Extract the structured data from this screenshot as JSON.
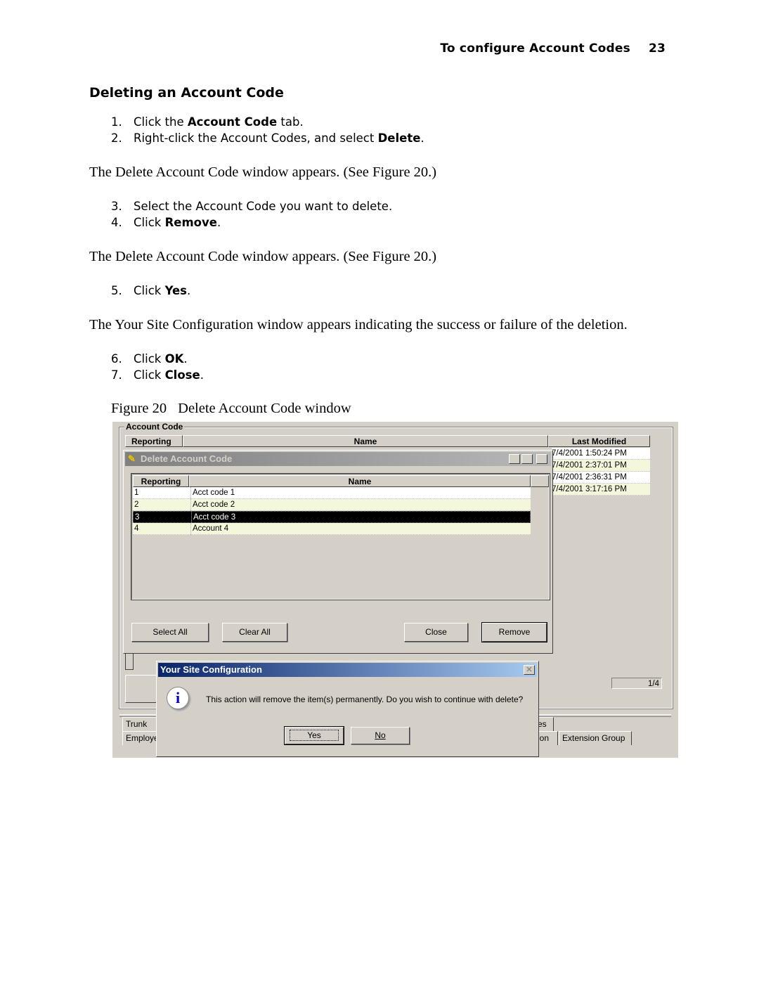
{
  "header": {
    "title": "To configure Account Codes",
    "page_number": "23"
  },
  "section_title": "Deleting an Account Code",
  "steps_a": [
    {
      "num": "1.",
      "pre": "Click the ",
      "bold": "Account Code",
      "post": " tab."
    },
    {
      "num": "2.",
      "pre": "Right-click the Account Codes, and select ",
      "bold": "Delete",
      "post": "."
    }
  ],
  "para1": "The Delete Account Code window appears. (See Figure 20.)",
  "steps_b": [
    {
      "num": "3.",
      "pre": "Select the Account Code you want to delete.",
      "bold": "",
      "post": ""
    },
    {
      "num": "4.",
      "pre": "Click ",
      "bold": "Remove",
      "post": "."
    }
  ],
  "para2": "The Delete Account Code window appears. (See Figure 20.)",
  "steps_c": [
    {
      "num": "5.",
      "pre": "Click ",
      "bold": "Yes",
      "post": "."
    }
  ],
  "para3": "The Your Site Configuration window appears indicating the success or failure of the deletion.",
  "steps_d": [
    {
      "num": "6.",
      "pre": "Click ",
      "bold": "OK",
      "post": "."
    },
    {
      "num": "7.",
      "pre": "Click ",
      "bold": "Close",
      "post": "."
    }
  ],
  "figure": {
    "label": "Figure 20",
    "caption": "Delete Account Code window"
  },
  "screenshot": {
    "group_label": "Account Code",
    "bg_columns": {
      "reporting": "Reporting",
      "name": "Name",
      "last_modified": "Last Modified"
    },
    "last_modified_values": [
      "7/4/2001 1:50:24 PM",
      "7/4/2001 2:37:01 PM",
      "7/4/2001 2:36:31 PM",
      "7/4/2001 3:17:16 PM"
    ],
    "page_indicator": "1/4",
    "delete_dialog": {
      "title": "Delete Account Code",
      "columns": {
        "reporting": "Reporting",
        "name": "Name"
      },
      "rows": [
        {
          "reporting": "1",
          "name": "Acct code 1"
        },
        {
          "reporting": "2",
          "name": "Acct code 2"
        },
        {
          "reporting": "3",
          "name": "Acct code 3"
        },
        {
          "reporting": "4",
          "name": "Account 4"
        }
      ],
      "selected_row": 3,
      "buttons": {
        "select_all": "Select All",
        "clear_all": "Clear All",
        "close": "Close",
        "remove": "Remove"
      }
    },
    "confirm_dialog": {
      "title": "Your Site Configuration",
      "message": "This action will remove the item(s) permanently. Do you wish to continue with delete?",
      "yes": "Yes",
      "no": "No"
    },
    "tabs": {
      "trunk": "Trunk",
      "employee": "Employe",
      "es_partial": "es",
      "ion_partial": "ion",
      "extension_group": "Extension Group"
    }
  }
}
